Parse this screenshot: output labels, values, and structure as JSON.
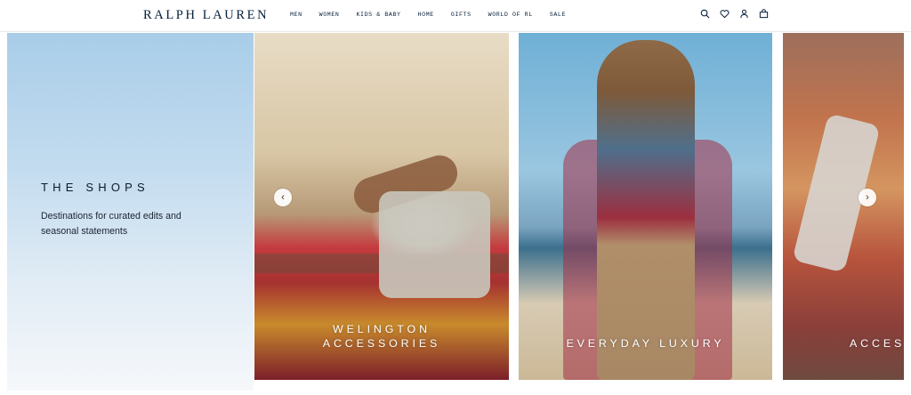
{
  "header": {
    "logo": "RALPH LAUREN",
    "nav": [
      "MEN",
      "WOMEN",
      "KIDS & BABY",
      "HOME",
      "GIFTS",
      "WORLD OF RL",
      "SALE"
    ],
    "icons": [
      "search-icon",
      "heart-icon",
      "account-icon",
      "bag-icon"
    ]
  },
  "hero": {
    "title": "THE SHOPS",
    "description": "Destinations for curated edits and seasonal statements",
    "cards": [
      {
        "line1": "WELINGTON",
        "line2": "ACCESSORIES"
      },
      {
        "line1": "EVERYDAY LUXURY"
      },
      {
        "line1": "ACCES"
      }
    ],
    "arrows": {
      "prev": "‹",
      "next": "›"
    }
  },
  "colors": {
    "brand_navy": "#041e3a",
    "intro_sky": "#a9cde8"
  }
}
